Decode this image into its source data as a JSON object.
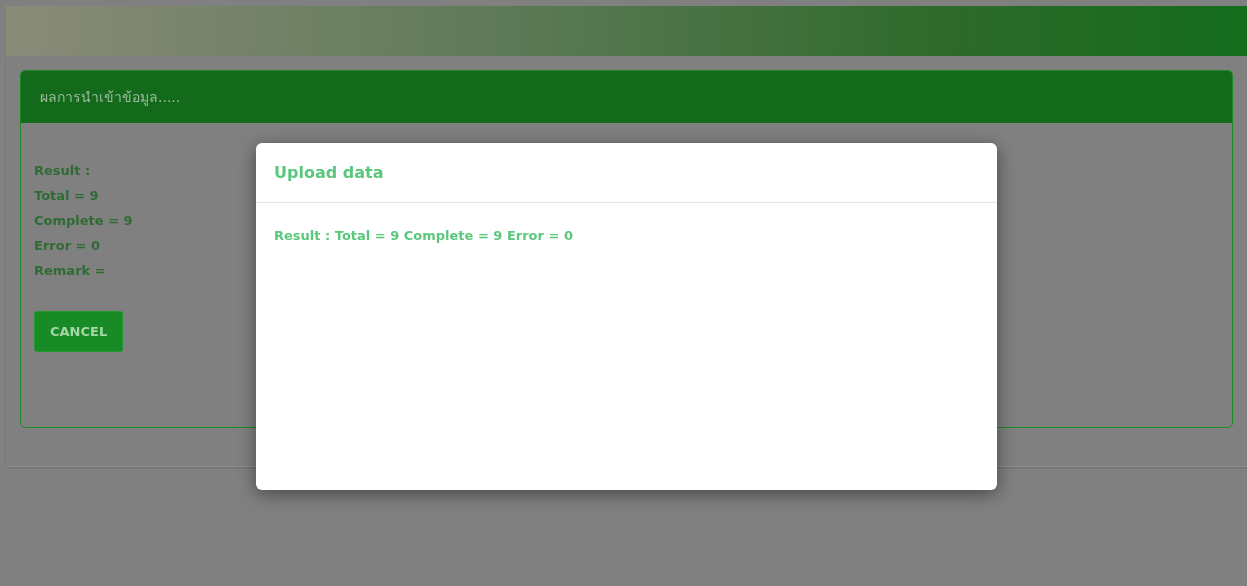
{
  "page": {
    "panel": {
      "title": "ผลการนำเข้าข้อมูล.....",
      "result_lines": [
        "Result :",
        "Total = 9",
        "Complete = 9",
        "Error = 0",
        "Remark ="
      ],
      "cancel_button": "CANCEL"
    }
  },
  "modal": {
    "title": "Upload data",
    "message": "Result : Total = 9 Complete = 9 Error = 0"
  }
}
